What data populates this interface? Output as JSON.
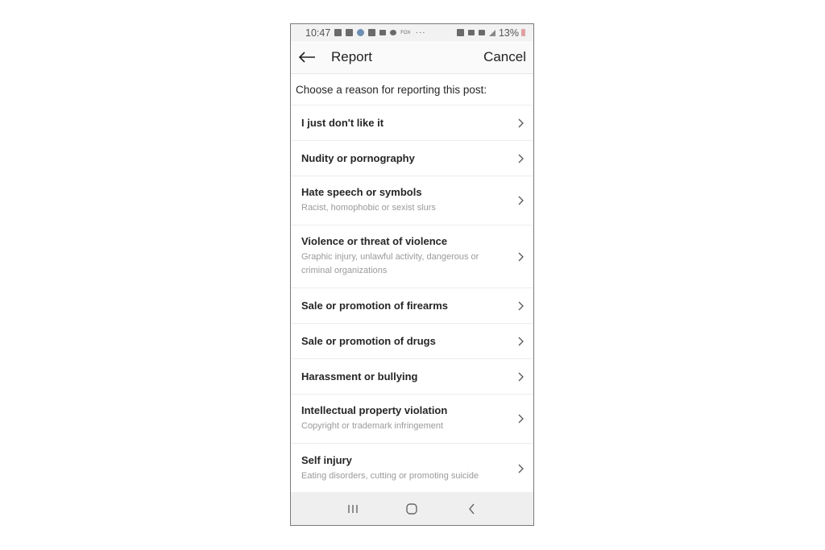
{
  "status_bar": {
    "time": "10:47",
    "icons": [
      "youtube-icon",
      "calendar-icon",
      "settings-icon",
      "linkedin-icon",
      "mail-icon",
      "pinwheel-icon",
      "fox-news-icon",
      "more-dots-icon"
    ],
    "fox_label": "FOX",
    "more": "···",
    "right_icons": [
      "alarm-icon",
      "mute-icon",
      "data-icon",
      "signal-icon"
    ],
    "battery": "13%"
  },
  "header": {
    "title": "Report",
    "cancel_label": "Cancel"
  },
  "prompt": "Choose a reason for reporting this post:",
  "reasons": [
    {
      "label": "I just don't like it",
      "desc": ""
    },
    {
      "label": "Nudity or pornography",
      "desc": ""
    },
    {
      "label": "Hate speech or symbols",
      "desc": "Racist, homophobic or sexist slurs"
    },
    {
      "label": "Violence or threat of violence",
      "desc": "Graphic injury, unlawful activity, dangerous or criminal organizations"
    },
    {
      "label": "Sale or promotion of firearms",
      "desc": ""
    },
    {
      "label": "Sale or promotion of drugs",
      "desc": ""
    },
    {
      "label": "Harassment or bullying",
      "desc": ""
    },
    {
      "label": "Intellectual property violation",
      "desc": "Copyright or trademark infringement"
    },
    {
      "label": "Self injury",
      "desc": "Eating disorders, cutting or promoting suicide"
    }
  ],
  "nav_bar": {
    "buttons": [
      "recent-apps",
      "home",
      "back"
    ]
  }
}
